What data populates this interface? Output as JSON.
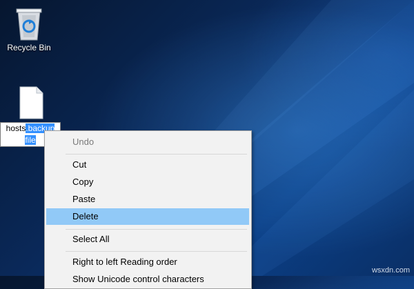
{
  "desktop": {
    "recycle_bin_label": "Recycle Bin",
    "file": {
      "name_prefix": "hosts",
      "name_selected_line1": ".backup",
      "name_selected_line2": "file"
    }
  },
  "context_menu": {
    "items": [
      {
        "label": "Undo",
        "state": "disabled"
      },
      {
        "label": "Cut",
        "state": "normal"
      },
      {
        "label": "Copy",
        "state": "normal"
      },
      {
        "label": "Paste",
        "state": "normal"
      },
      {
        "label": "Delete",
        "state": "highlighted"
      },
      {
        "label": "Select All",
        "state": "normal"
      },
      {
        "label": "Right to left Reading order",
        "state": "normal"
      },
      {
        "label": "Show Unicode control characters",
        "state": "normal"
      }
    ]
  },
  "colors": {
    "selection": "#3390ff",
    "menu_highlight": "#91c9f7",
    "menu_bg": "#f2f2f2"
  },
  "watermark": "wsxdn.com"
}
